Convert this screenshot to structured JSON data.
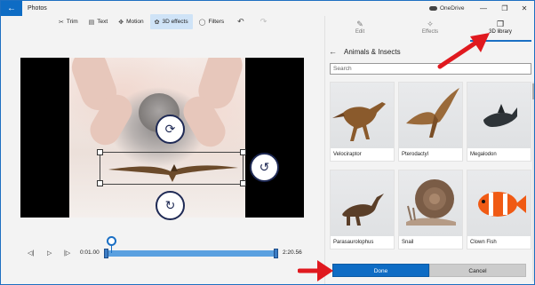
{
  "window": {
    "title": "Photos",
    "account": "OneDrive",
    "controls": [
      "—",
      "❐",
      "✕"
    ]
  },
  "toolbar": {
    "items": [
      {
        "label": "Trim",
        "icon": "trim-icon"
      },
      {
        "label": "Text",
        "icon": "text-icon"
      },
      {
        "label": "Motion",
        "icon": "motion-icon"
      },
      {
        "label": "3D effects",
        "icon": "3d-effects-icon",
        "active": true
      },
      {
        "label": "Filters",
        "icon": "filters-icon"
      }
    ]
  },
  "player": {
    "time_start": "0:01.00",
    "time_end": "2:20.56",
    "progress": 0.03
  },
  "panel": {
    "tabs": [
      {
        "label": "Edit",
        "icon": "pencil-icon"
      },
      {
        "label": "Effects",
        "icon": "sparkle-icon"
      },
      {
        "label": "3D library",
        "icon": "cube-icon",
        "active": true
      }
    ],
    "category": "Animals & Insects",
    "search_placeholder": "Search",
    "items": [
      {
        "label": "Velociraptor"
      },
      {
        "label": "Pterodactyl"
      },
      {
        "label": "Megalodon"
      },
      {
        "label": "Parasaurolophus"
      },
      {
        "label": "Snail"
      },
      {
        "label": "Clown Fish"
      }
    ],
    "done_label": "Done",
    "cancel_label": "Cancel"
  },
  "colors": {
    "accent": "#0e6cc4",
    "annotation_arrow": "#e0191f"
  }
}
